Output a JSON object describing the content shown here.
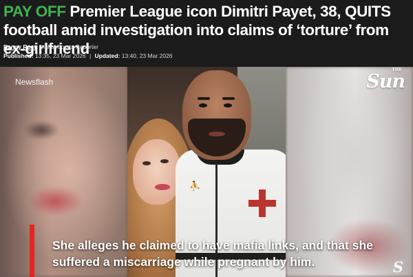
{
  "headline": {
    "kicker": "PAY OFF",
    "text": "Premier League icon Dimitri Payet, 38, QUITS football amid investigation into claims of ‘torture’ from ex-girlfriend"
  },
  "byline": {
    "author": "Danny Rust",
    "role": ", Digital Sports Reporter"
  },
  "dates": {
    "published_label": "Published:",
    "published_value": "13:35, 23 Mar 2026",
    "separator": "|",
    "updated_label": "Updated:",
    "updated_value": "13:40, 23 Mar 2026"
  },
  "video": {
    "source_watermark": "Newsflash",
    "brand_logo": "Sun",
    "brand_logo_small": "THE",
    "caption": "She alleges he claimed to have mafia links, and that she suffered a miscarriage while pregnant by him.",
    "corner_logo": "S",
    "caption_bar_color": "#e4261f",
    "kicker_color": "#3fb34f"
  }
}
